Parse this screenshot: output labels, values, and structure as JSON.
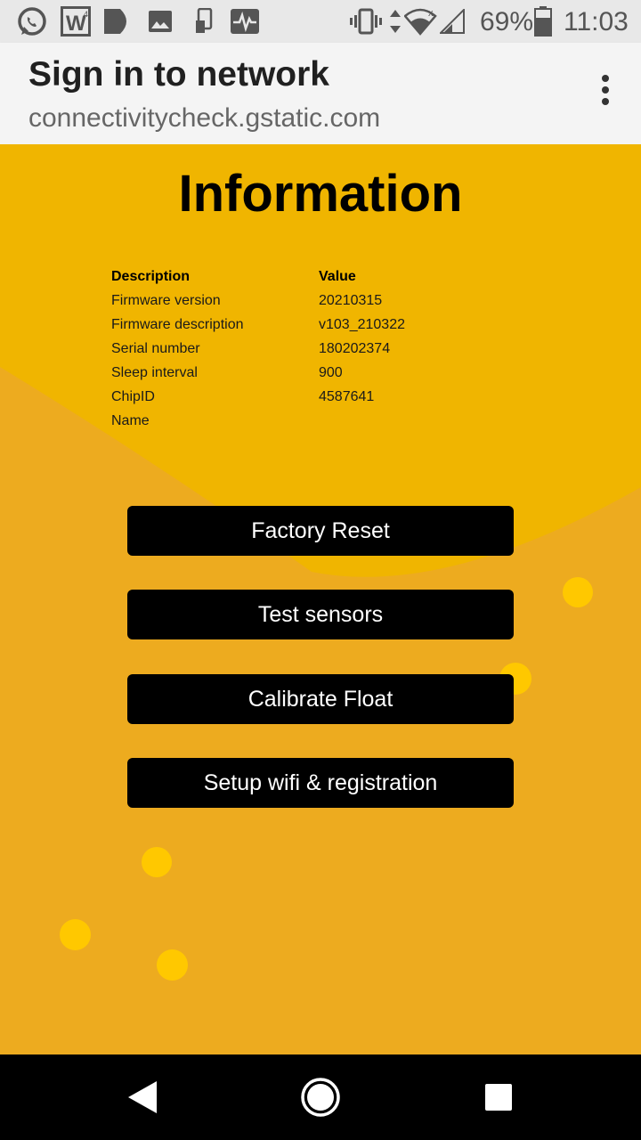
{
  "status_bar": {
    "battery_percent": "69%",
    "time": "11:03",
    "left_icons": [
      "whatsapp-icon",
      "w-app-icon",
      "play-store-icon",
      "image-icon",
      "phone-sim-icon",
      "activity-icon"
    ],
    "right_icons": [
      "vibrate-icon",
      "data-arrows-icon",
      "wifi-icon",
      "signal-icon",
      "battery-icon"
    ]
  },
  "header": {
    "title": "Sign in to network",
    "url": "connectivitycheck.gstatic.com",
    "menu_icon": "more-vert-icon"
  },
  "page": {
    "title": "Information",
    "table": {
      "headers": [
        "Description",
        "Value"
      ],
      "rows": [
        {
          "description": "Firmware version",
          "value": "20210315"
        },
        {
          "description": "Firmware description",
          "value": "v103_210322"
        },
        {
          "description": "Serial number",
          "value": "180202374"
        },
        {
          "description": "Sleep interval",
          "value": "900"
        },
        {
          "description": "ChipID",
          "value": "4587641"
        },
        {
          "description": "Name",
          "value": ""
        }
      ]
    },
    "buttons": [
      {
        "label": "Factory Reset"
      },
      {
        "label": "Test sensors"
      },
      {
        "label": "Calibrate Float"
      },
      {
        "label": "Setup wifi & registration"
      }
    ],
    "colors": {
      "background": "#f0b500",
      "wave": "#edab1f",
      "dots": "#ffc800",
      "button": "#000000"
    }
  },
  "nav_bar": {
    "icons": [
      "back-icon",
      "home-icon",
      "recents-icon"
    ]
  }
}
